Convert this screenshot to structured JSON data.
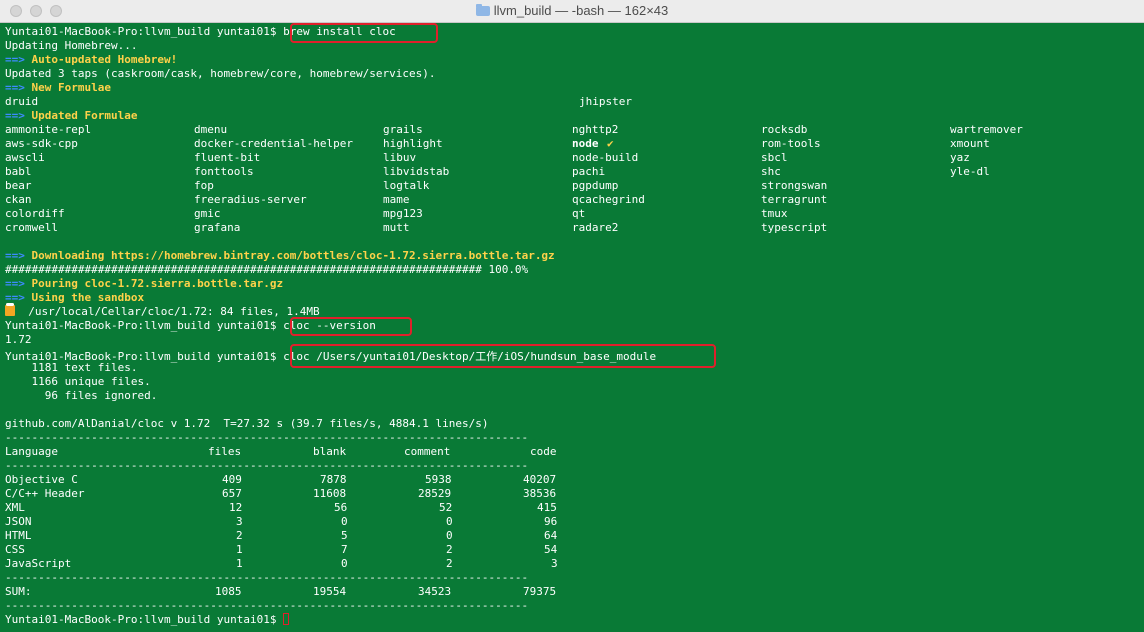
{
  "window": {
    "title": "llvm_build — -bash — 162×43"
  },
  "prompt": "Yuntai01-MacBook-Pro:llvm_build yuntai01$",
  "commands": {
    "brew": "brew install cloc",
    "version": "cloc --version",
    "cloc": "cloc /Users/yuntai01/Desktop/工作/iOS/hundsun_base_module"
  },
  "brew": {
    "updating": "Updating Homebrew...",
    "arrow": "==>",
    "auto_updated": "Auto-updated Homebrew!",
    "updated_taps": "Updated 3 taps (caskroom/cask, homebrew/core, homebrew/services).",
    "new_formulae_header": "New Formulae",
    "new_formulae": [
      "druid",
      "jhipster"
    ],
    "updated_formulae_header": "Updated Formulae",
    "updated_formulae_rows": [
      [
        "ammonite-repl",
        "dmenu",
        "grails",
        "nghttp2",
        "rocksdb",
        "wartremover"
      ],
      [
        "aws-sdk-cpp",
        "docker-credential-helper",
        "highlight",
        "node",
        "rom-tools",
        "xmount"
      ],
      [
        "awscli",
        "fluent-bit",
        "libuv",
        "node-build",
        "sbcl",
        "yaz"
      ],
      [
        "babl",
        "fonttools",
        "libvidstab",
        "pachi",
        "shc",
        "yle-dl"
      ],
      [
        "bear",
        "fop",
        "logtalk",
        "pgpdump",
        "strongswan",
        ""
      ],
      [
        "ckan",
        "freeradius-server",
        "mame",
        "qcachegrind",
        "terragrunt",
        ""
      ],
      [
        "colordiff",
        "gmic",
        "mpg123",
        "qt",
        "tmux",
        ""
      ],
      [
        "cromwell",
        "grafana",
        "mutt",
        "radare2",
        "typescript",
        ""
      ]
    ],
    "node_check": "✔",
    "downloading": "Downloading https://homebrew.bintray.com/bottles/cloc-1.72.sierra.bottle.tar.gz",
    "progress_bar": "######################################################################## 100.0%",
    "pouring": "Pouring cloc-1.72.sierra.bottle.tar.gz",
    "sandbox": "Using the sandbox",
    "installed": "/usr/local/Cellar/cloc/1.72: 84 files, 1.4MB"
  },
  "version_output": "1.72",
  "cloc": {
    "text_files": "    1181 text files.",
    "unique_files": "    1166 unique files.",
    "ignored_files": "      96 files ignored.",
    "summary": "github.com/AlDanial/cloc v 1.72  T=27.32 s (39.7 files/s, 4884.1 lines/s)",
    "divider": "-------------------------------------------------------------------------------",
    "columns": [
      "Language",
      "files",
      "blank",
      "comment",
      "code"
    ],
    "rows": [
      [
        "Objective C",
        "409",
        "7878",
        "5938",
        "40207"
      ],
      [
        "C/C++ Header",
        "657",
        "11608",
        "28529",
        "38536"
      ],
      [
        "XML",
        "12",
        "56",
        "52",
        "415"
      ],
      [
        "JSON",
        "3",
        "0",
        "0",
        "96"
      ],
      [
        "HTML",
        "2",
        "5",
        "0",
        "64"
      ],
      [
        "CSS",
        "1",
        "7",
        "2",
        "54"
      ],
      [
        "JavaScript",
        "1",
        "0",
        "2",
        "3"
      ]
    ],
    "sum": [
      "SUM:",
      "1085",
      "19554",
      "34523",
      "79375"
    ]
  },
  "colors": {
    "background": "#097a36",
    "highlight": "#e0202b",
    "arrow": "#3d8bff",
    "header": "#ffd24a"
  }
}
